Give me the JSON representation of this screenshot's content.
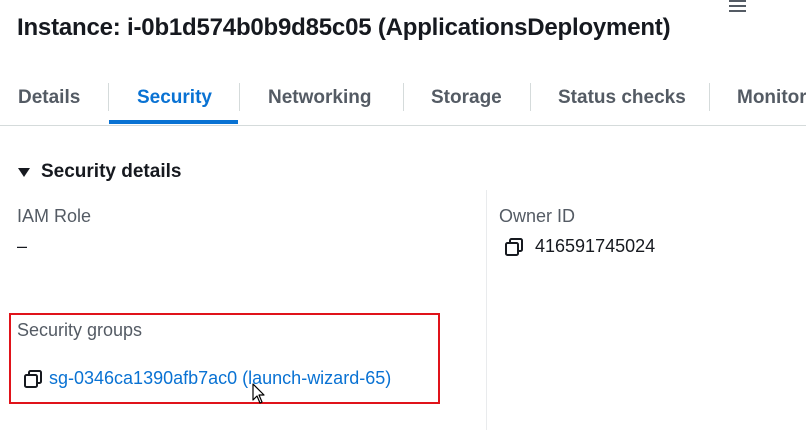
{
  "header": {
    "title": "Instance: i-0b1d574b0b9d85c05 (ApplicationsDeployment)",
    "menu_icon": "hamburger-menu-icon"
  },
  "tabs": [
    {
      "label": "Details",
      "active": false
    },
    {
      "label": "Security",
      "active": true
    },
    {
      "label": "Networking",
      "active": false
    },
    {
      "label": "Storage",
      "active": false
    },
    {
      "label": "Status checks",
      "active": false
    },
    {
      "label": "Monitoring",
      "active": false
    }
  ],
  "security_details": {
    "heading": "Security details",
    "expanded": true,
    "iam_role": {
      "label": "IAM Role",
      "value": "–"
    },
    "owner_id": {
      "label": "Owner ID",
      "value": "416591745024",
      "icon": "copy-icon"
    },
    "security_groups": {
      "label": "Security groups",
      "link_text": "sg-0346ca1390afb7ac0 (launch-wizard-65)",
      "icon": "copy-icon"
    }
  },
  "colors": {
    "accent": "#0972d3",
    "text": "#16191f",
    "muted": "#545b64",
    "highlight": "#e0131a"
  }
}
